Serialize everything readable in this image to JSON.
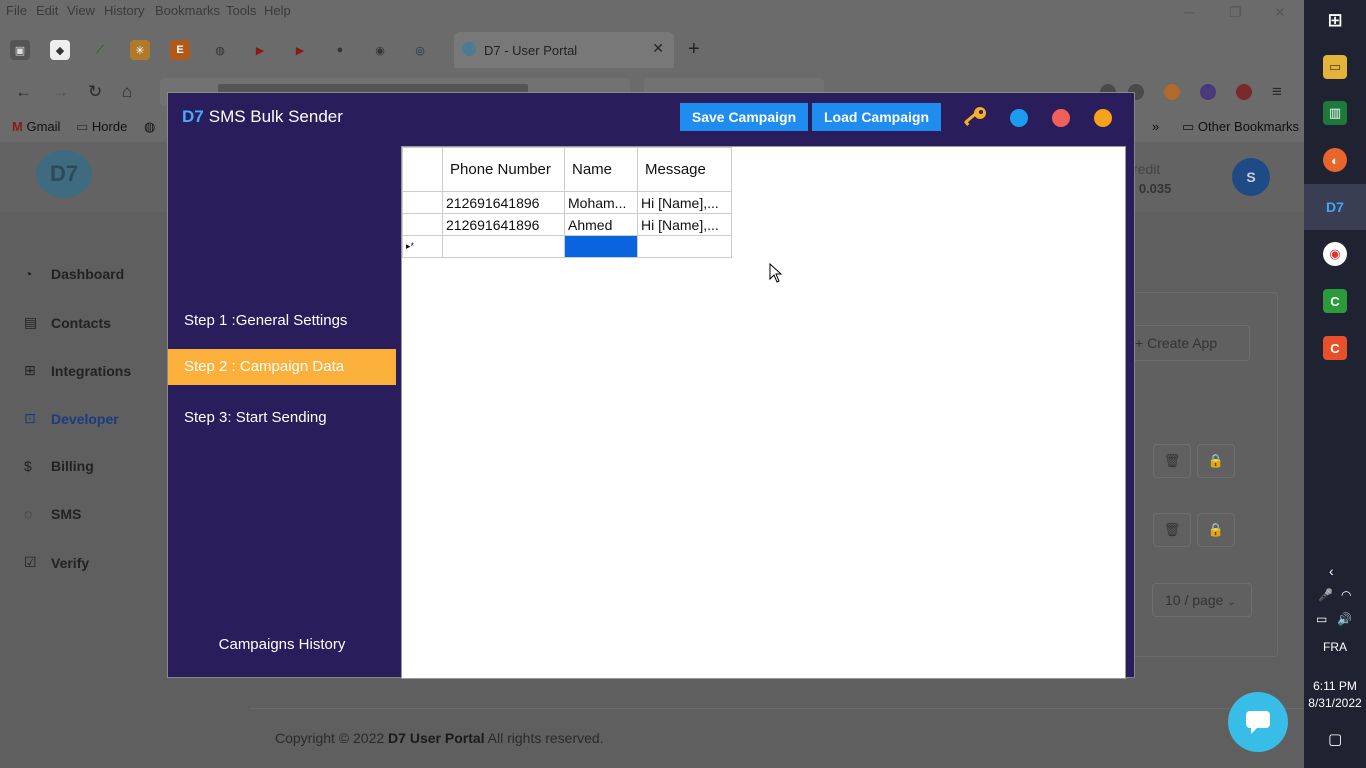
{
  "browser": {
    "menu": [
      "File",
      "Edit",
      "View",
      "History",
      "Bookmarks",
      "Tools",
      "Help"
    ],
    "tab_title": "D7 - User Portal",
    "bookmarks": [
      "Gmail",
      "Horde"
    ],
    "other_bookmarks": "Other Bookmarks"
  },
  "portal": {
    "credit_label": "redit",
    "credit_value": "0 0.035",
    "avatar_letter": "S",
    "sidebar": [
      {
        "label": "Dashboard",
        "icon": "dashboard-icon"
      },
      {
        "label": "Contacts",
        "icon": "contacts-icon"
      },
      {
        "label": "Integrations",
        "icon": "integrations-icon"
      },
      {
        "label": "Developer",
        "icon": "developer-icon"
      },
      {
        "label": "Billing",
        "icon": "billing-icon"
      },
      {
        "label": "SMS",
        "icon": "sms-icon"
      },
      {
        "label": "Verify",
        "icon": "verify-icon"
      }
    ],
    "create_app": "Create App",
    "per_page": "10 / page",
    "footer": {
      "prefix": "Copyright © 2022",
      "brand": "D7 User Portal",
      "suffix": "All rights reserved."
    }
  },
  "app": {
    "brand": "D7",
    "title": "SMS Bulk Sender",
    "save_label": "Save Campaign",
    "load_label": "Load Campaign",
    "steps": [
      "Step 1 :General Settings",
      "Step 2 : Campaign Data",
      "Step 3: Start Sending"
    ],
    "active_step": 1,
    "history_label": "Campaigns History",
    "colors": {
      "bg": "#291d5b",
      "accent": "#fbb03b",
      "button": "#1f8cf0",
      "dot_blue": "#1e9bf0",
      "dot_red": "#f0605a",
      "dot_orange": "#f7a21b"
    },
    "grid": {
      "headers": [
        "Phone Number",
        "Name",
        "Message"
      ],
      "rows": [
        [
          "212691641896",
          "Moham...",
          "Hi [Name],..."
        ],
        [
          "212691641896",
          "Ahmed",
          "Hi [Name],..."
        ]
      ],
      "new_row_marker": "▸*"
    }
  },
  "taskbar": {
    "lang": "FRA",
    "time": "6:11 PM",
    "date": "8/31/2022"
  }
}
